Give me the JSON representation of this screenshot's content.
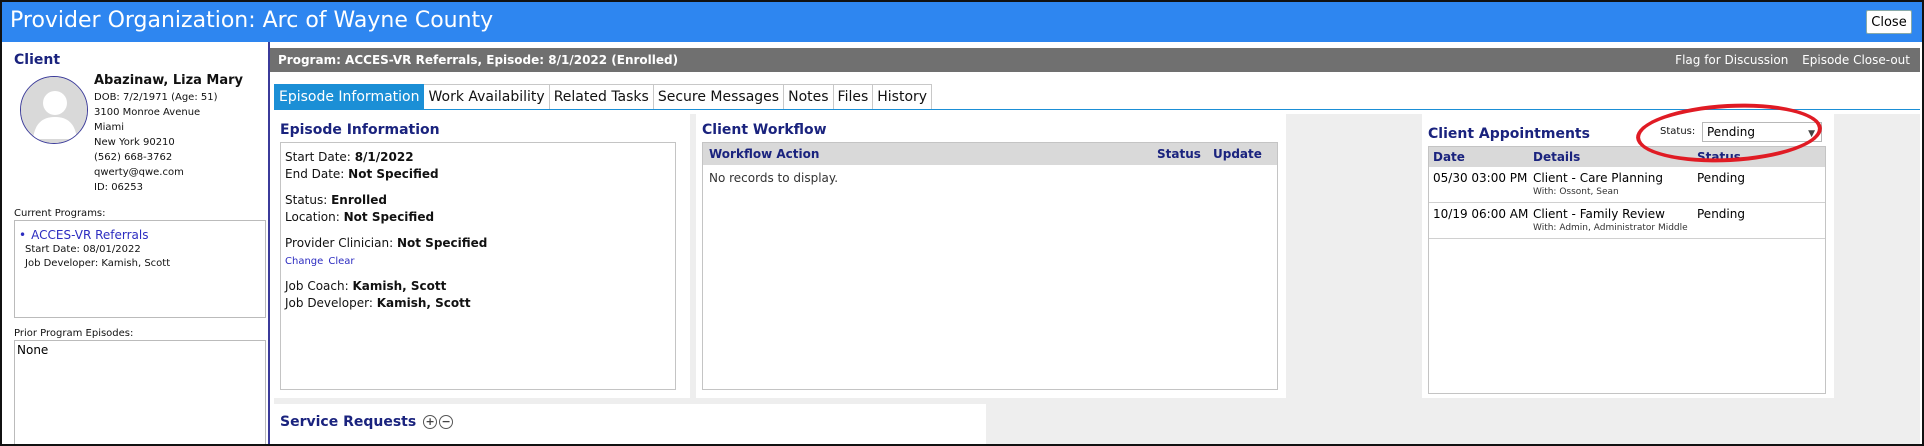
{
  "window": {
    "title": "Provider Organization: Arc of Wayne County",
    "close_label": "Close"
  },
  "client": {
    "heading": "Client",
    "avatar_icon": "user-silhouette-icon",
    "name": "Abazinaw, Liza Mary",
    "dob": "DOB: 7/2/1971 (Age: 51)",
    "address1": "3100 Monroe Avenue",
    "city": "Miami",
    "state_zip": "New York 90210",
    "phone": "(562) 668-3762",
    "email": "qwerty@qwe.com",
    "id": "ID: 06253",
    "current_programs_label": "Current Programs:",
    "program_link": "ACCES-VR Referrals",
    "program_start": "Start Date: 08/01/2022",
    "program_job_dev": "Job Developer: Kamish, Scott",
    "prior_label": "Prior Program Episodes:",
    "prior_value": "None"
  },
  "program_header": {
    "title": "Program: ACCES-VR Referrals, Episode: 8/1/2022 (Enrolled)",
    "flag_label": "Flag for Discussion",
    "closeout_label": "Episode Close-out"
  },
  "tabs": [
    "Episode Information",
    "Work Availability",
    "Related Tasks",
    "Secure Messages",
    "Notes",
    "Files",
    "History"
  ],
  "episode": {
    "heading": "Episode Information",
    "start_label": "Start Date:",
    "start_value": "8/1/2022",
    "end_label": "End Date:",
    "end_value": "Not Specified",
    "status_label": "Status:",
    "status_value": "Enrolled",
    "location_label": "Location:",
    "location_value": "Not Specified",
    "clinician_label": "Provider Clinician:",
    "clinician_value": "Not Specified",
    "change_label": "Change",
    "clear_label": "Clear",
    "coach_label": "Job Coach:",
    "coach_value": "Kamish, Scott",
    "developer_label": "Job Developer:",
    "developer_value": "Kamish, Scott"
  },
  "workflow": {
    "heading": "Client Workflow",
    "col_action": "Workflow Action",
    "col_status": "Status",
    "col_update": "Update",
    "empty_text": "No records to display."
  },
  "appointments": {
    "heading": "Client Appointments",
    "status_label": "Status:",
    "status_selected": "Pending",
    "col_date": "Date",
    "col_details": "Details",
    "col_status": "Status",
    "rows": [
      {
        "date": "05/30 03:00 PM",
        "details": "Client - Care Planning",
        "with": "With: Ossont, Sean",
        "status": "Pending"
      },
      {
        "date": "10/19 06:00 AM",
        "details": "Client - Family Review",
        "with": "With: Admin, Administrator Middle",
        "status": "Pending"
      }
    ],
    "highlight_color": "#e01b24"
  },
  "service_requests": {
    "heading": "Service Requests",
    "add_icon": "plus-circle-icon",
    "remove_icon": "minus-circle-icon"
  },
  "colors": {
    "titlebar": "#2e86f0",
    "header_bar": "#707070",
    "active_tab": "#1b8fd6",
    "heading_text": "#1a237e",
    "link": "#2c2cc0"
  }
}
